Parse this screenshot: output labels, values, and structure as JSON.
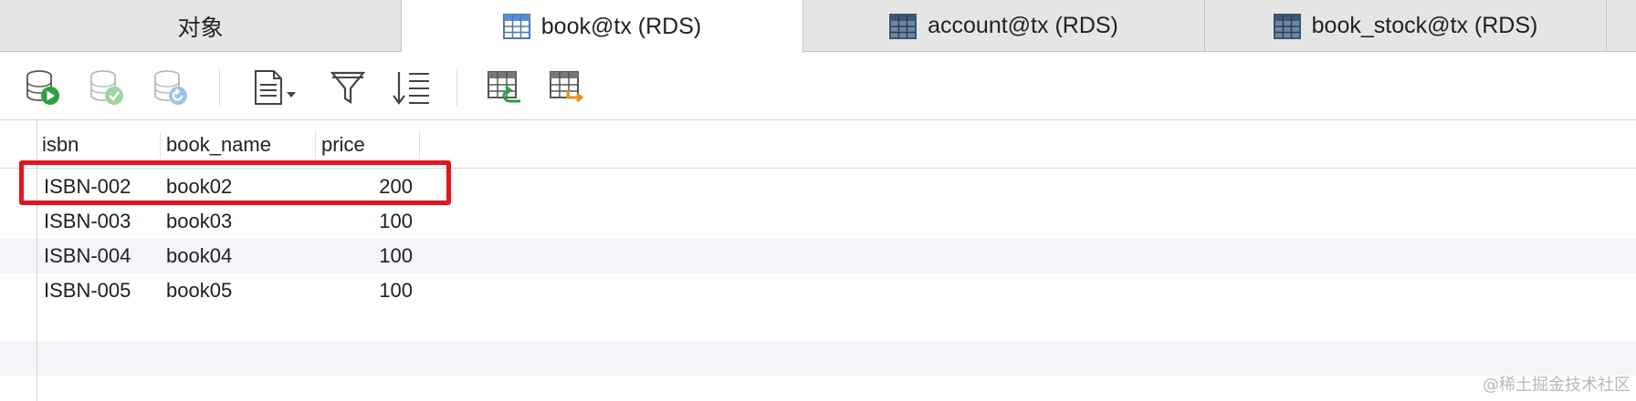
{
  "tabs": [
    {
      "label": "对象",
      "icon": "none"
    },
    {
      "label": "book@tx (RDS)",
      "icon": "table-icon",
      "active": true
    },
    {
      "label": "account@tx (RDS)",
      "icon": "table-icon"
    },
    {
      "label": "book_stock@tx (RDS)",
      "icon": "table-icon"
    }
  ],
  "toolbar": {
    "buttons": [
      "begin-transaction-icon",
      "commit-icon",
      "rollback-icon",
      "text-view-icon",
      "filter-icon",
      "sort-icon",
      "import-icon",
      "export-icon"
    ]
  },
  "grid": {
    "columns": [
      "isbn",
      "book_name",
      "price"
    ],
    "rows": [
      [
        "ISBN-002",
        "book02",
        "200"
      ],
      [
        "ISBN-003",
        "book03",
        "100"
      ],
      [
        "ISBN-004",
        "book04",
        "100"
      ],
      [
        "ISBN-005",
        "book05",
        "100"
      ]
    ],
    "highlighted_row": 0
  },
  "colors": {
    "highlight": "#e3151d",
    "stripe": "#f3f5f9"
  },
  "watermark": "@稀土掘金技术社区"
}
